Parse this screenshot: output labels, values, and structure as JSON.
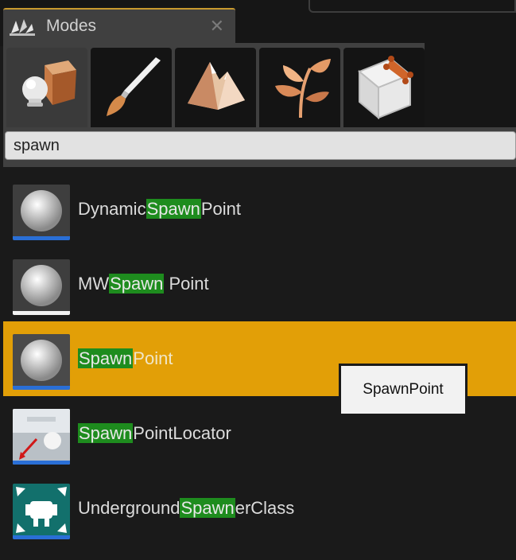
{
  "tab": {
    "title": "Modes",
    "close": "✕"
  },
  "modes": [
    {
      "name": "place-mode-button",
      "icon": "place-icon",
      "active": true
    },
    {
      "name": "paint-mode-button",
      "icon": "paintbrush-icon",
      "active": false
    },
    {
      "name": "landscape-mode-button",
      "icon": "mountain-icon",
      "active": false
    },
    {
      "name": "foliage-mode-button",
      "icon": "leaf-icon",
      "active": false
    },
    {
      "name": "geometry-mode-button",
      "icon": "cube-icon",
      "active": false
    }
  ],
  "search": {
    "value": "spawn"
  },
  "items": [
    {
      "pre": "Dynamic",
      "match": "Spawn",
      "post": "Point",
      "thumb": "sphere-thumb-icon",
      "bar": "#2a6fd6",
      "selected": false
    },
    {
      "pre": "MW",
      "match": "Spawn",
      "post": " Point",
      "thumb": "sphere-thumb-icon",
      "bar": "#f2f2f2",
      "selected": false
    },
    {
      "pre": "",
      "match": "Spawn",
      "post": "Point",
      "thumb": "sphere-thumb-icon",
      "bar": "#2a6fd6",
      "selected": true
    },
    {
      "pre": "",
      "match": "Spawn",
      "post": "PointLocator",
      "thumb": "locator-thumb-icon",
      "bar": "#2a6fd6",
      "selected": false
    },
    {
      "pre": "Underground",
      "match": "Spawn",
      "post": "erClass",
      "thumb": "spawner-thumb-icon",
      "bar": "#2a6fd6",
      "selected": false
    }
  ],
  "tooltip": {
    "text": "SpawnPoint"
  },
  "colors": {
    "selected": "#e29f07",
    "highlight": "#1e8c1e",
    "accent": "#c99a2e"
  }
}
